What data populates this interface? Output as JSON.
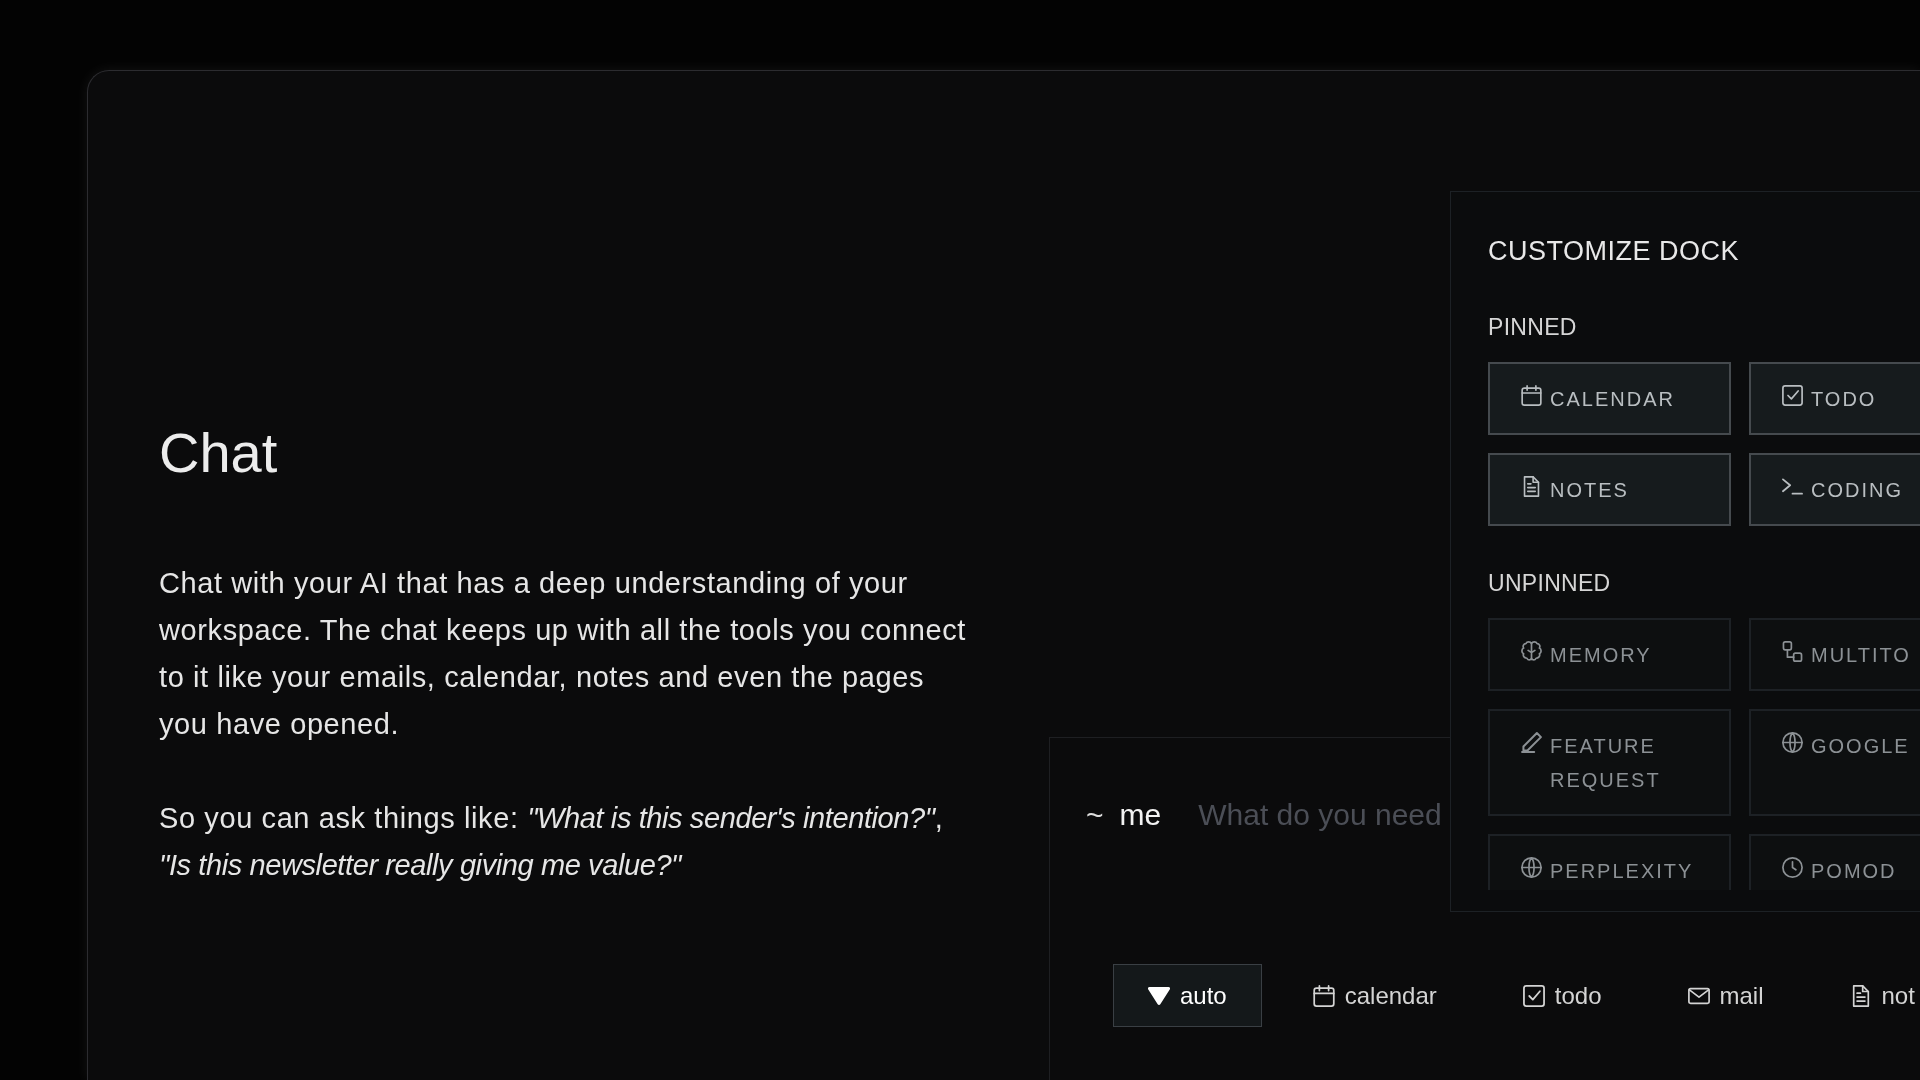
{
  "intro": {
    "title": "Chat",
    "paragraphs": [
      "Chat with your AI that has a deep understanding of your workspace. The chat keeps up with all the tools you connect to it like your emails, calendar, notes and even the pages you have opened.",
      "So you can ask things like: *\"What is this sender's intention?\"*, *\"Is this newsletter really giving me value?\"*"
    ]
  },
  "chat_input": {
    "prompt": "~",
    "user": "me",
    "placeholder": "What do you need",
    "tools": [
      {
        "kind": "auto",
        "label": "auto",
        "selected": true
      },
      {
        "kind": "calendar",
        "label": "calendar",
        "selected": false
      },
      {
        "kind": "todo",
        "label": "todo",
        "selected": false
      },
      {
        "kind": "mail",
        "label": "mail",
        "selected": false
      },
      {
        "kind": "notes",
        "label": "not",
        "selected": false
      }
    ]
  },
  "dock": {
    "title": "CUSTOMIZE DOCK",
    "groups": [
      {
        "label": "PINNED",
        "items": [
          {
            "kind": "calendar",
            "label": "CALENDAR",
            "pinned": true
          },
          {
            "kind": "todo",
            "label": "TODO",
            "pinned": true
          },
          {
            "kind": "notes",
            "label": "NOTES",
            "pinned": true
          },
          {
            "kind": "coding",
            "label": "CODING",
            "pinned": true
          }
        ]
      },
      {
        "label": "UNPINNED",
        "items": [
          {
            "kind": "memory",
            "label": "MEMORY",
            "pinned": false
          },
          {
            "kind": "multitool",
            "label": "MULTITO",
            "pinned": false
          },
          {
            "kind": "feature_request",
            "label": "FEATURE REQUEST",
            "pinned": false
          },
          {
            "kind": "google",
            "label": "GOOGLE",
            "pinned": false
          },
          {
            "kind": "perplexity",
            "label": "PERPLEXITY",
            "pinned": false
          },
          {
            "kind": "pomodoro",
            "label": "POMOD",
            "pinned": false
          }
        ]
      }
    ]
  }
}
